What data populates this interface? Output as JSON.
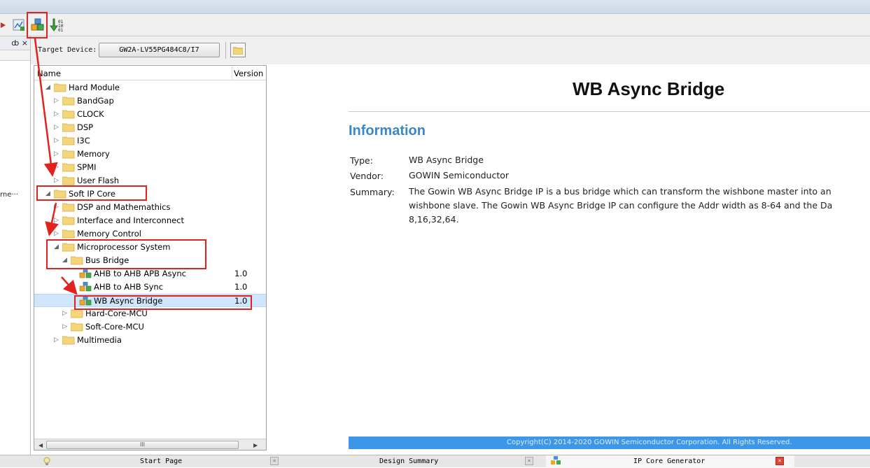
{
  "target_device": {
    "label": "Target Device:",
    "value": "GW2A-LV55PG484C8/I7"
  },
  "left_panel": {
    "dock_controls": "ȸ ×",
    "clipped_text": "rne···"
  },
  "tree": {
    "header": {
      "name": "Name",
      "version": "Version"
    },
    "rows": [
      {
        "label": "Hard Module",
        "version": "",
        "depth": 0,
        "state": "open"
      },
      {
        "label": "BandGap",
        "version": "",
        "depth": 1,
        "state": "closed"
      },
      {
        "label": "CLOCK",
        "version": "",
        "depth": 1,
        "state": "closed"
      },
      {
        "label": "DSP",
        "version": "",
        "depth": 1,
        "state": "closed"
      },
      {
        "label": "I3C",
        "version": "",
        "depth": 1,
        "state": "closed"
      },
      {
        "label": "Memory",
        "version": "",
        "depth": 1,
        "state": "closed"
      },
      {
        "label": "SPMI",
        "version": "",
        "depth": 1,
        "state": "closed"
      },
      {
        "label": "User Flash",
        "version": "",
        "depth": 1,
        "state": "closed"
      },
      {
        "label": "Soft IP Core",
        "version": "",
        "depth": 0,
        "state": "open"
      },
      {
        "label": "DSP and Mathemathics",
        "version": "",
        "depth": 1,
        "state": "closed"
      },
      {
        "label": "Interface and Interconnect",
        "version": "",
        "depth": 1,
        "state": "closed"
      },
      {
        "label": "Memory Control",
        "version": "",
        "depth": 1,
        "state": "closed"
      },
      {
        "label": "Microprocessor System",
        "version": "",
        "depth": 1,
        "state": "open"
      },
      {
        "label": "Bus Bridge",
        "version": "",
        "depth": 2,
        "state": "open"
      },
      {
        "label": "AHB to AHB APB Async",
        "version": "1.0",
        "depth": 3,
        "state": "leaf"
      },
      {
        "label": "AHB to AHB Sync",
        "version": "1.0",
        "depth": 3,
        "state": "leaf"
      },
      {
        "label": "WB Async Bridge",
        "version": "1.0",
        "depth": 3,
        "state": "leaf"
      },
      {
        "label": "Hard-Core-MCU",
        "version": "",
        "depth": 2,
        "state": "closed"
      },
      {
        "label": "Soft-Core-MCU",
        "version": "",
        "depth": 2,
        "state": "closed"
      },
      {
        "label": "Multimedia",
        "version": "",
        "depth": 1,
        "state": "closed"
      }
    ],
    "selected_index": 16,
    "scroll_grip": "III"
  },
  "details": {
    "title": "WB Async Bridge",
    "section": "Information",
    "type_label": "Type:",
    "type_value": "WB Async Bridge",
    "vendor_label": "Vendor:",
    "vendor_value": "GOWIN Semiconductor",
    "summary_label": "Summary:",
    "summary_line1": "The Gowin WB Async Bridge IP is a bus bridge which can transform the wishbone master into an",
    "summary_line2": "wishbone slave. The Gowin WB Async Bridge IP can configure the Addr width as 8-64 and the Da",
    "summary_line3": "8,16,32,64."
  },
  "footer": {
    "copyright": "Copyright(C) 2014-2020 GOWIN Semiconductor Corporation. All Rights Reserved."
  },
  "bottom_tabs": [
    {
      "label": "Start Page",
      "icon": "lightbulb-icon"
    },
    {
      "label": "Design Summary",
      "icon": ""
    },
    {
      "label": "IP Core Generator",
      "icon": "ip-core-icon",
      "active": true
    }
  ],
  "colors": {
    "accent": "#3b86c6",
    "footer_bg": "#3d97e8",
    "highlight": "#e2221f",
    "selection": "#cfe5fb",
    "folder": "#f5d57a"
  }
}
